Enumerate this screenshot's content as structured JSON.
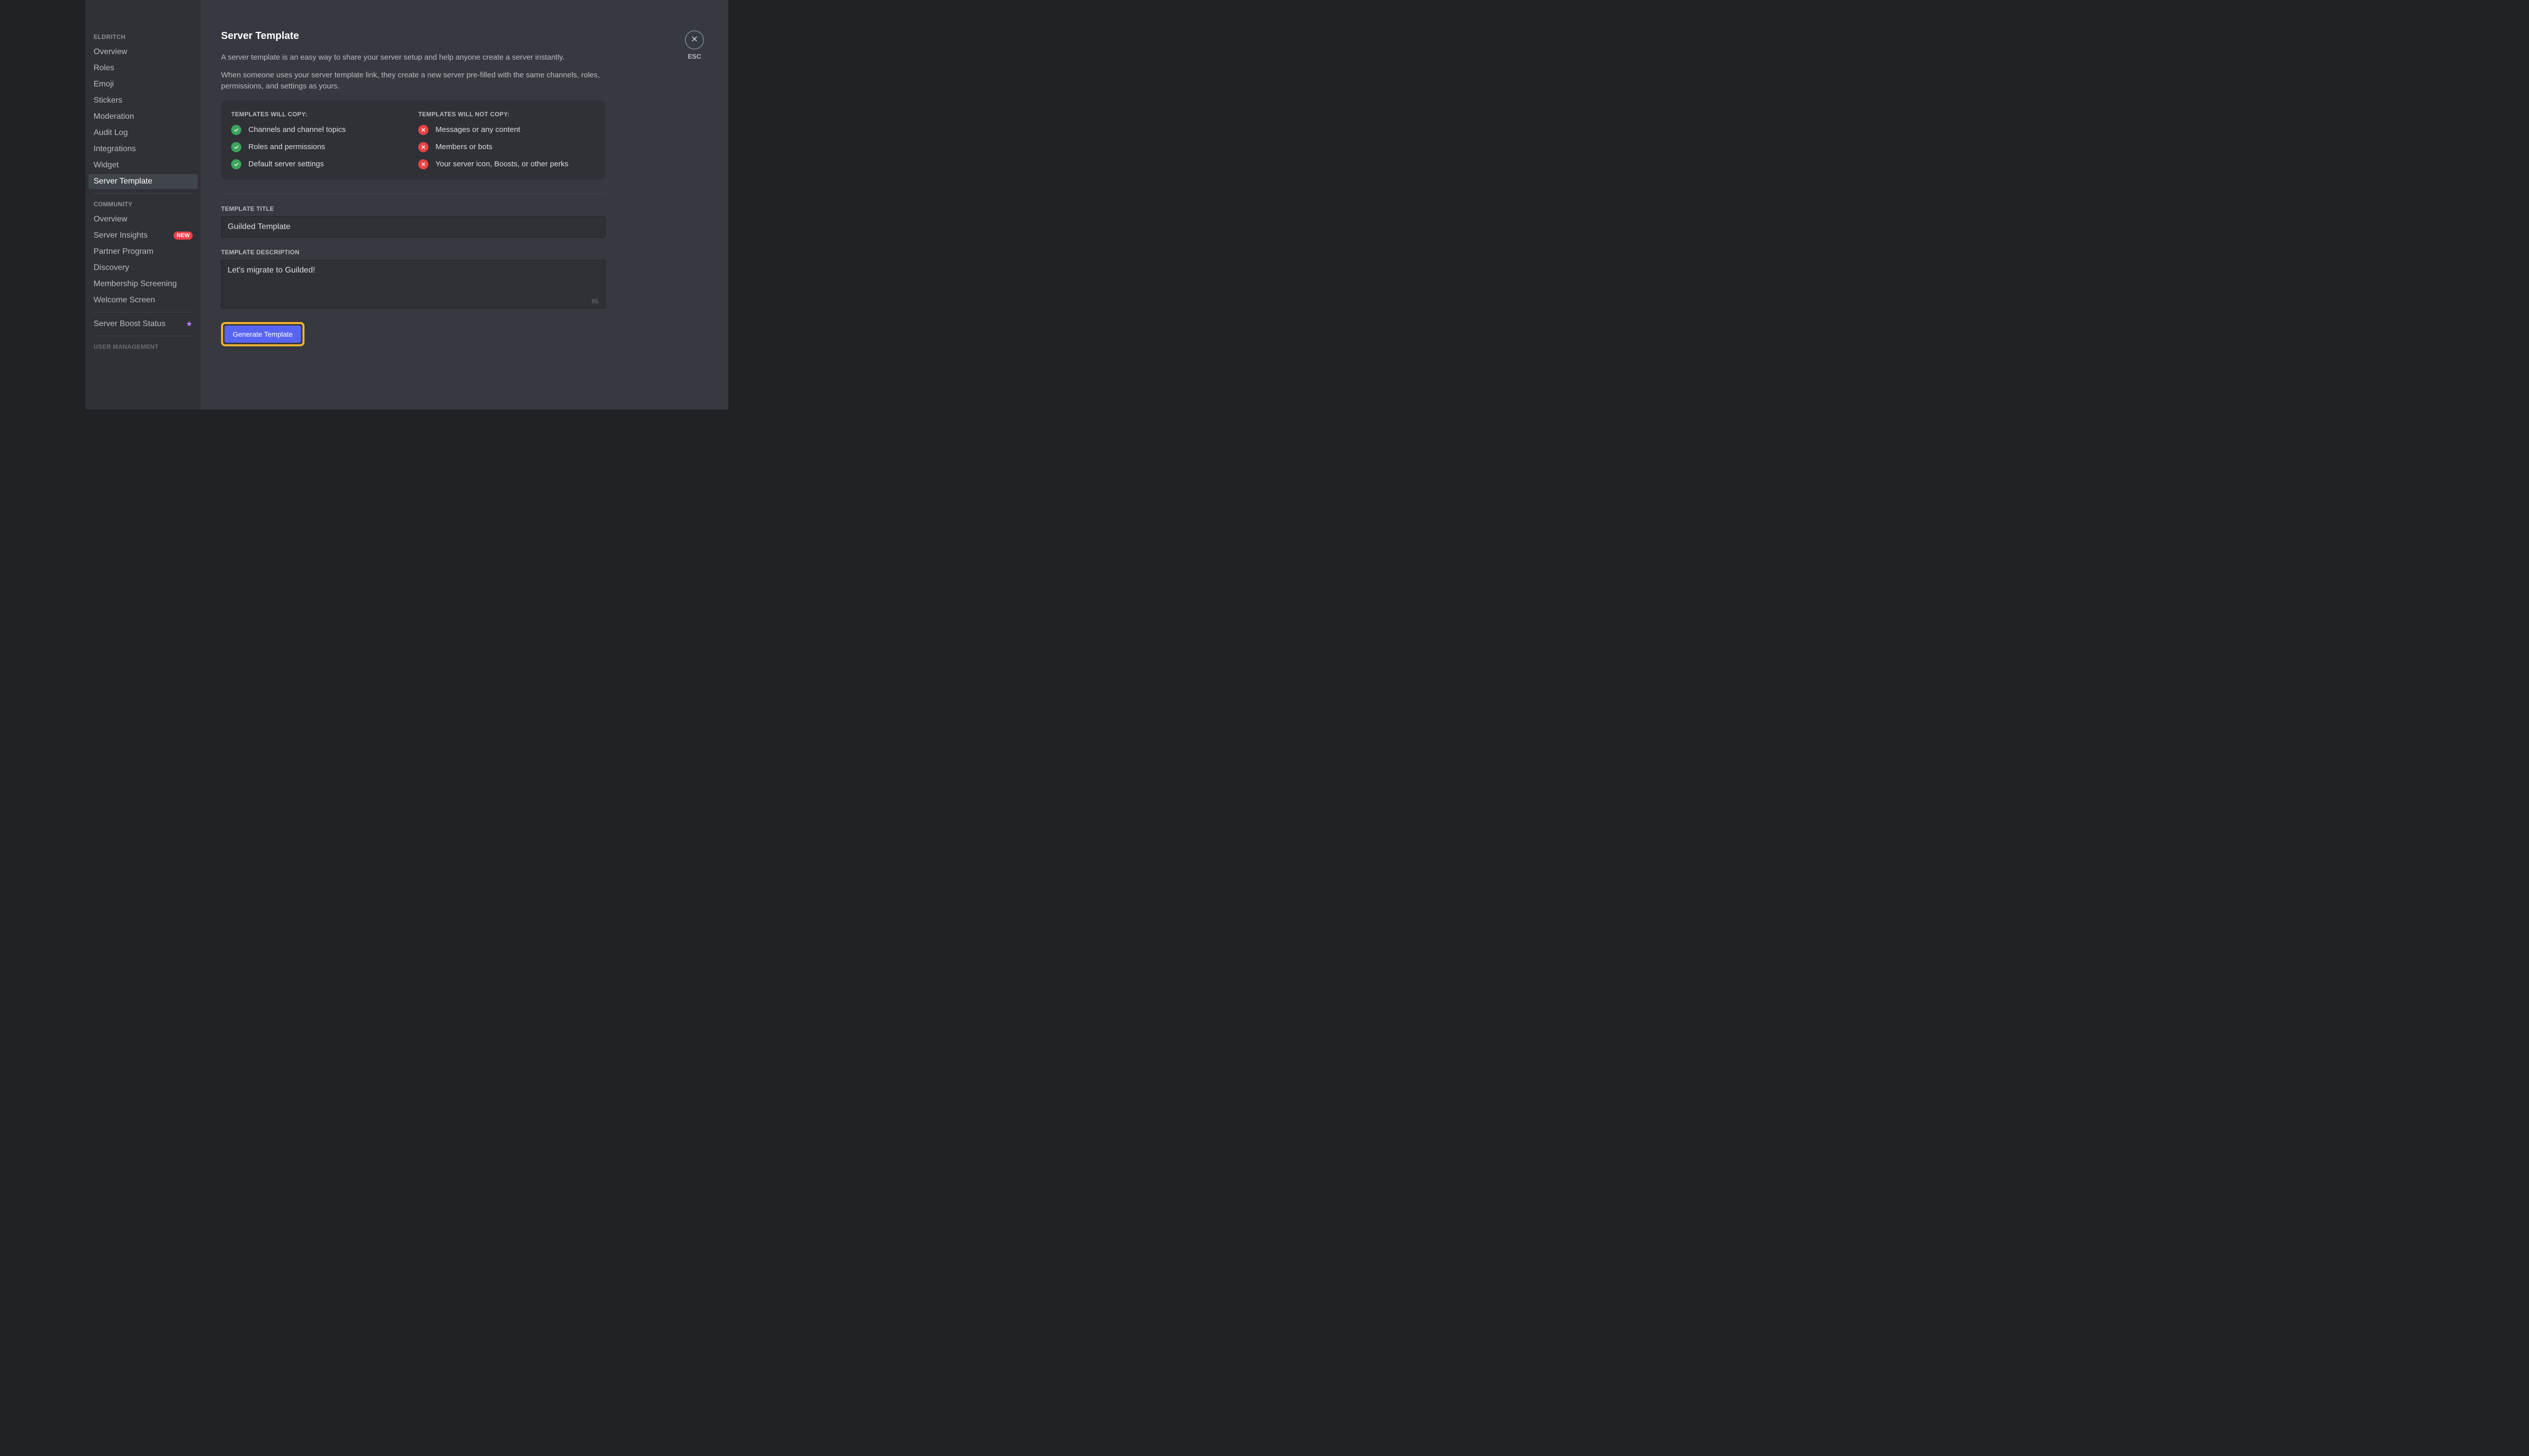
{
  "sidebar": {
    "server_name": "ELDRITCH",
    "primary": [
      {
        "label": "Overview"
      },
      {
        "label": "Roles"
      },
      {
        "label": "Emoji"
      },
      {
        "label": "Stickers"
      },
      {
        "label": "Moderation"
      },
      {
        "label": "Audit Log"
      },
      {
        "label": "Integrations"
      },
      {
        "label": "Widget"
      },
      {
        "label": "Server Template",
        "active": true
      }
    ],
    "community_header": "COMMUNITY",
    "community": [
      {
        "label": "Overview"
      },
      {
        "label": "Server Insights",
        "badge": "NEW"
      },
      {
        "label": "Partner Program"
      },
      {
        "label": "Discovery"
      },
      {
        "label": "Membership Screening"
      },
      {
        "label": "Welcome Screen"
      }
    ],
    "boost": {
      "label": "Server Boost Status"
    },
    "user_mgmt_header": "USER MANAGEMENT"
  },
  "content": {
    "title": "Server Template",
    "desc1": "A server template is an easy way to share your server setup and help anyone create a server instantly.",
    "desc2": "When someone uses your server template link, they create a new server pre-filled with the same channels, roles, permissions, and settings as yours.",
    "will_copy_header": "TEMPLATES WILL COPY:",
    "will_copy": [
      "Channels and channel topics",
      "Roles and permissions",
      "Default server settings"
    ],
    "will_not_copy_header": "TEMPLATES WILL NOT COPY:",
    "will_not_copy": [
      "Messages or any content",
      "Members or bots",
      "Your server icon, Boosts, or other perks"
    ],
    "title_field_label": "TEMPLATE TITLE",
    "title_value": "Guilded Template",
    "desc_field_label": "TEMPLATE DESCRIPTION",
    "desc_value": "Let's migrate to Guilded!",
    "char_counter": "95",
    "generate_label": "Generate Template",
    "esc_label": "ESC"
  },
  "colors": {
    "accent": "#5865f2",
    "highlight": "#f0b232",
    "green": "#3ba55d",
    "red": "#ed4245"
  }
}
